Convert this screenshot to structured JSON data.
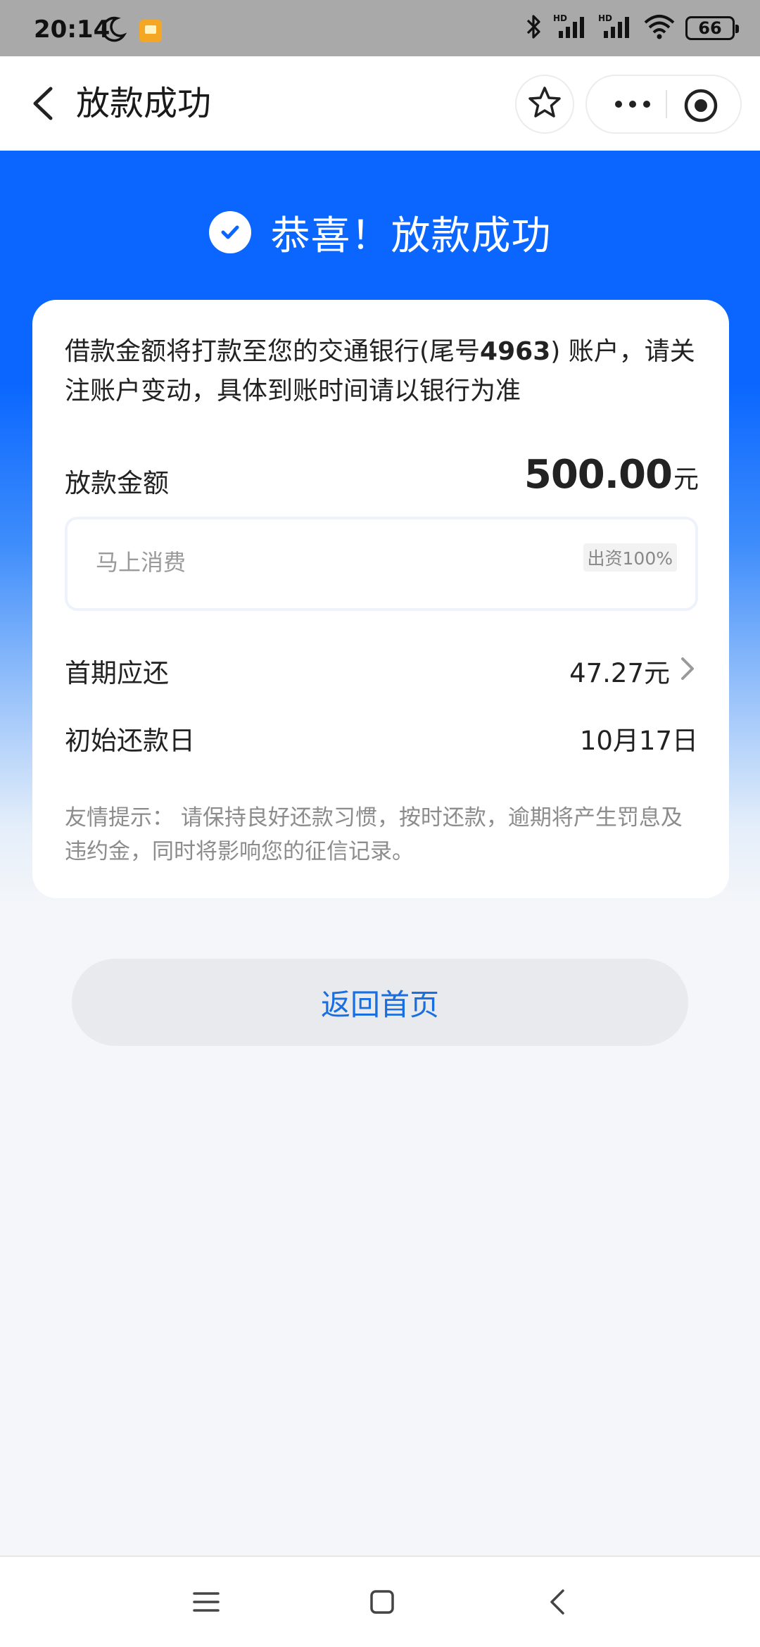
{
  "status_bar": {
    "time": "20:14",
    "battery": "66",
    "icons": [
      "moon-icon",
      "app-notification-icon",
      "bluetooth-icon",
      "signal-hd-icon",
      "signal-hd-icon",
      "wifi-icon",
      "battery-icon"
    ]
  },
  "nav": {
    "title": "放款成功",
    "icons": [
      "back-arrow-icon",
      "star-icon",
      "more-dots-icon",
      "close-circle-icon"
    ]
  },
  "hero": {
    "title": "恭喜！放款成功",
    "icon": "check-circle-icon"
  },
  "card": {
    "notice_prefix": "借款金额将打款至您的交通银行(尾号",
    "notice_card_tail": "4963",
    "notice_suffix": ") 账户，请关注账户变动，具体到账时间请以银行为准",
    "amount_label": "放款金额",
    "amount_value": "500.00",
    "amount_unit": "元",
    "lender_name": "马上消费",
    "lender_badge": "出资100%",
    "first_payment_label": "首期应还",
    "first_payment_value": "47.27元",
    "start_date_label": "初始还款日",
    "start_date_value": "10月17日",
    "tip_label": "友情提示：",
    "tip_text": "请保持良好还款习惯，按时还款，逾期将产生罚息及违约金，同时将影响您的征信记录。"
  },
  "button": {
    "home_label": "返回首页"
  },
  "colors": {
    "brand_blue": "#0a66ff",
    "link_blue": "#1a6fe0",
    "page_bg": "#f4f6f9"
  }
}
